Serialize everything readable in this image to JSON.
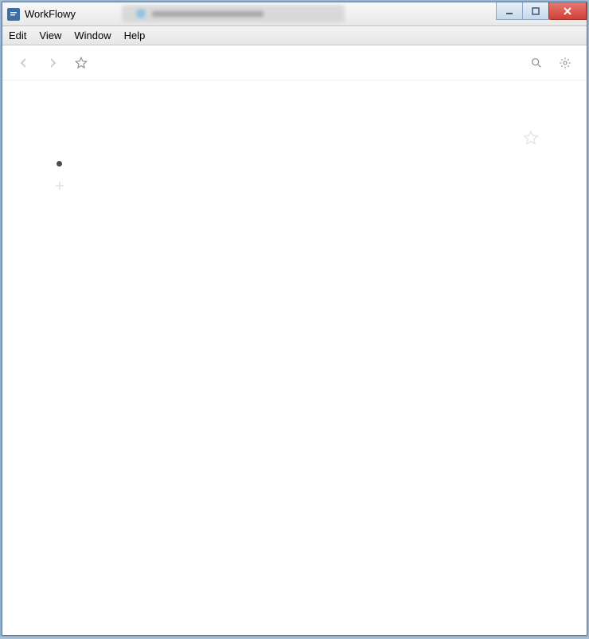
{
  "window": {
    "title": "WorkFlowy"
  },
  "menubar": {
    "items": [
      "Edit",
      "View",
      "Window",
      "Help"
    ]
  },
  "content": {
    "bullet_text": "",
    "add_placeholder": ""
  }
}
